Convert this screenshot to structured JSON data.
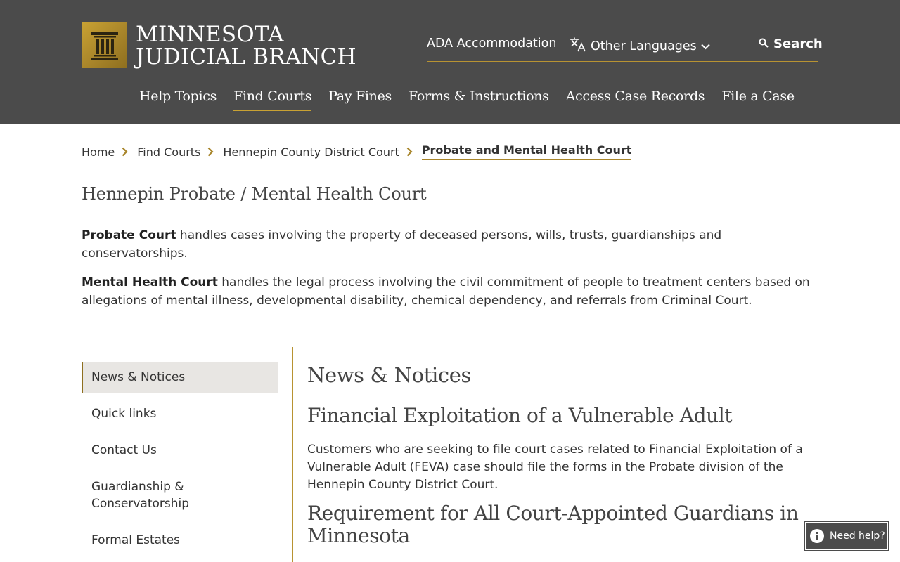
{
  "header": {
    "logo_line1": "MINNESOTA",
    "logo_line2": "JUDICIAL BRANCH",
    "utility": {
      "ada": "ADA Accommodation",
      "languages": "Other Languages",
      "search": "Search"
    },
    "nav": [
      {
        "label": "Help Topics"
      },
      {
        "label": "Find Courts"
      },
      {
        "label": "Pay Fines"
      },
      {
        "label": "Forms & Instructions"
      },
      {
        "label": "Access Case Records"
      },
      {
        "label": "File a Case"
      }
    ]
  },
  "breadcrumb": {
    "items": [
      "Home",
      "Find Courts",
      "Hennepin County District Court"
    ],
    "current": "Probate and Mental Health Court"
  },
  "page": {
    "title": "Hennepin Probate / Mental Health Court",
    "intro": [
      {
        "bold": "Probate Court",
        "text": " handles cases involving the property of deceased persons, wills, trusts, guardianships and conservatorships."
      },
      {
        "bold": "Mental Health Court",
        "text": " handles the legal process involving the civil commitment of people to treatment centers based on allegations of mental illness, developmental disability, chemical dependency, and referrals from Criminal Court."
      }
    ]
  },
  "sidebar": {
    "items": [
      {
        "label": "News & Notices"
      },
      {
        "label": "Quick links"
      },
      {
        "label": "Contact Us"
      },
      {
        "label": "Guardianship & Conservatorship"
      },
      {
        "label": "Formal Estates"
      }
    ]
  },
  "content": {
    "section_heading": "News & Notices",
    "articles": [
      {
        "title": "Financial Exploitation of a Vulnerable Adult",
        "body": "Customers who are seeking to file court cases related to Financial Exploitation of a Vulnerable Adult (FEVA) case should file the forms in the Probate division of the Hennepin County District Court."
      },
      {
        "title": "Requirement for All Court-Appointed Guardians in Minnesota"
      }
    ]
  },
  "help_widget": {
    "label": "Need help?"
  },
  "colors": {
    "header_bg": "#4b4b4b",
    "accent_gold": "#b89332",
    "active_bg": "#e8e6e3"
  }
}
